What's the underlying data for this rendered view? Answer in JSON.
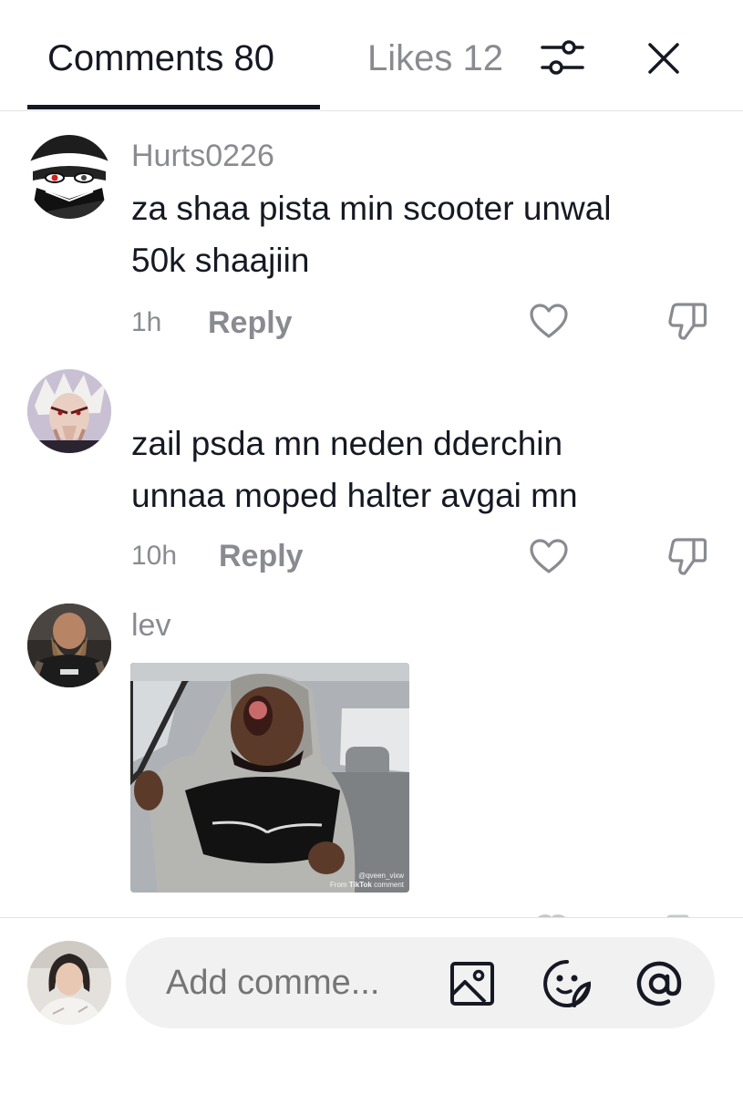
{
  "header": {
    "tabs": [
      {
        "label": "Comments 80",
        "active": true
      },
      {
        "label": "Likes 12",
        "active": false
      }
    ],
    "filter_icon": "sliders-icon",
    "close_icon": "close-icon"
  },
  "comments": [
    {
      "username": "Hurts0226",
      "text_lines": [
        "za shaa pista min scooter unwal",
        "50k shaajiin"
      ],
      "time": "1h",
      "reply_label": "Reply",
      "avatar": "anime-mask-avatar"
    },
    {
      "username": "",
      "text_lines": [
        "zail psda mn neden dderchin",
        "unnaa moped halter avgai mn"
      ],
      "time": "10h",
      "reply_label": "Reply",
      "avatar": "anime-white-hair-avatar"
    },
    {
      "username": "lev",
      "gif": {
        "watermark_handle": "@qveen_vixw",
        "watermark_from": "From",
        "watermark_app": "TikTok",
        "watermark_suffix": "comment"
      },
      "avatar": "bearded-man-avatar"
    }
  ],
  "composer": {
    "placeholder": "Add comme...",
    "icons": [
      "image-icon",
      "sticker-icon",
      "mention-icon"
    ],
    "user_avatar": "current-user-avatar"
  },
  "colors": {
    "text_primary": "#161823",
    "text_secondary": "#8a8b91",
    "input_bg": "#f1f1f2",
    "divider": "#e3e3e4"
  }
}
